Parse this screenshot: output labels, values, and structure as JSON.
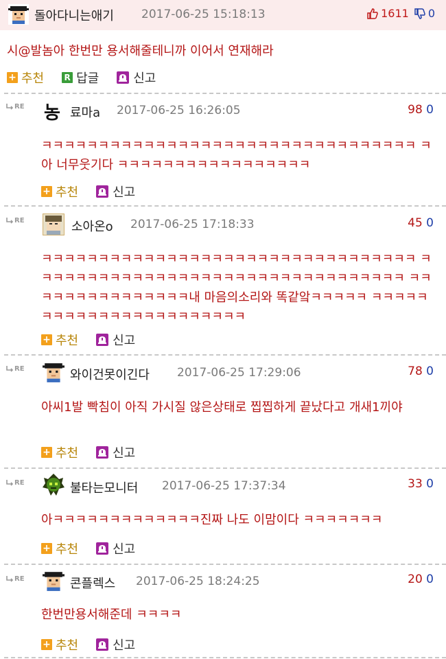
{
  "post": {
    "author": "돌아다니는애기",
    "date": "2017-06-25 15:18:13",
    "up": "1611",
    "down": "0",
    "title": "시@발놈아 한번만 용서해줄테니까 이어서 연재해라",
    "actions": {
      "recommend": "추천",
      "reply": "답글",
      "report": "신고"
    }
  },
  "comments": [
    {
      "author": "료마a",
      "date": "2017-06-25 16:26:05",
      "up": "98",
      "down": "0",
      "text": "ㅋㅋㅋㅋㅋㅋㅋㅋㅋㅋㅋㅋㅋㅋㅋㅋㅋㅋㅋㅋㅋㅋㅋㅋㅋㅋㅋㅋㅋㅋㅋㅋㅋ ㅋ아 너무웃기다 ㅋㅋㅋㅋㅋㅋㅋㅋㅋㅋㅋㅋㅋㅋㅋㅋㅋ",
      "recommend": "추천",
      "report": "신고"
    },
    {
      "author": "소아온o",
      "date": "2017-06-25 17:18:33",
      "up": "45",
      "down": "0",
      "text": "ㅋㅋㅋㅋㅋㅋㅋㅋㅋㅋㅋㅋㅋㅋㅋㅋㅋㅋㅋㅋㅋㅋㅋㅋㅋㅋㅋㅋㅋㅋㅋㅋㅋ ㅋㅋㅋㅋㅋㅋㅋㅋㅋㅋㅋㅋㅋㅋㅋㅋㅋㅋㅋㅋㅋㅋㅋㅋㅋㅋㅋㅋㅋㅋㅋㅋㅋ ㅋㅋㅋㅋㅋㅋㅋㅋㅋㅋㅋㅋㅋㅋㅋ내 마음의소리와 똑같앜ㅋㅋㅋㅋㅋ ㅋㅋㅋㅋㅋㅋㅋㅋㅋㅋㅋㅋㅋㅋㅋㅋㅋㅋㅋㅋㅋㅋㅋ",
      "recommend": "추천",
      "report": "신고"
    },
    {
      "author": "와이건못이긴다",
      "date": "2017-06-25 17:29:06",
      "up": "78",
      "down": "0",
      "text": "아씨1발 빡침이 아직 가시질 않은상태로 찝찝하게 끝났다고 개새1끼야",
      "recommend": "추천",
      "report": "신고"
    },
    {
      "author": "불타는모니터",
      "date": "2017-06-25 17:37:34",
      "up": "33",
      "down": "0",
      "text": "아ㅋㅋㅋㅋㅋㅋㅋㅋㅋㅋㅋㅋㅋ진짜 나도 이맘이다 ㅋㅋㅋㅋㅋㅋㅋ",
      "recommend": "추천",
      "report": "신고"
    },
    {
      "author": "콘플렉스",
      "date": "2017-06-25 18:24:25",
      "up": "20",
      "down": "0",
      "text": "한번만용서해준데 ㅋㅋㅋㅋ",
      "recommend": "추천",
      "report": "신고"
    }
  ],
  "re_label": "RE",
  "nong_glyph": "농",
  "colors": {
    "header_bg": "#fbecec",
    "text_red": "#b41616",
    "vote_blue": "#1f3fa8",
    "recommend_orange": "#f3a01c",
    "reply_green": "#3a9d3a",
    "report_purple": "#a0249c"
  }
}
